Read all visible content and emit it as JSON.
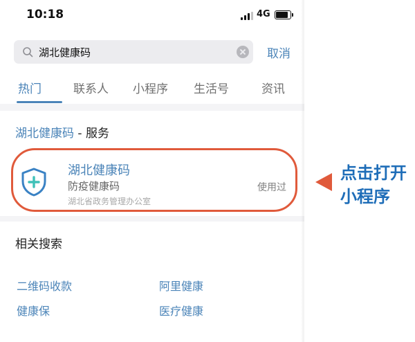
{
  "status_bar": {
    "time": "10:18",
    "network": "4G"
  },
  "search": {
    "query": "湖北健康码",
    "cancel_label": "取消"
  },
  "tabs": [
    {
      "label": "热门",
      "active": true
    },
    {
      "label": "联系人"
    },
    {
      "label": "小程序"
    },
    {
      "label": "生活号"
    },
    {
      "label": "资讯"
    }
  ],
  "service_section": {
    "title_keyword": "湖北健康码",
    "title_suffix": " - 服务",
    "item": {
      "name": "湖北健康码",
      "description": "防疫健康码",
      "organization": "湖北省政务管理办公室",
      "badge": "使用过"
    }
  },
  "related": {
    "title": "相关搜索",
    "links": [
      "二维码收款",
      "阿里健康",
      "健康保",
      "医疗健康"
    ]
  },
  "annotation": {
    "line1": "点击打开",
    "line2": "小程序"
  },
  "colors": {
    "accent": "#4b84b8",
    "highlight": "#e05a3b",
    "callout": "#1e6db8"
  }
}
